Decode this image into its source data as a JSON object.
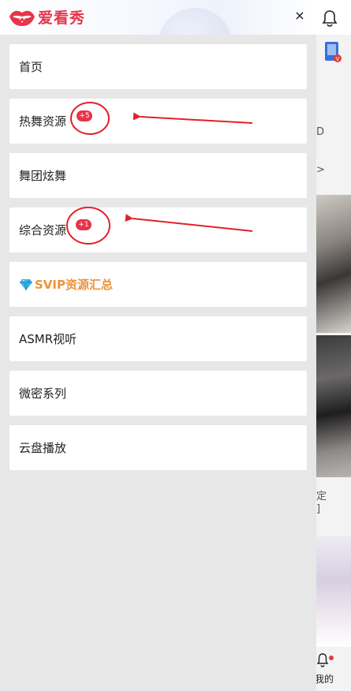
{
  "app": {
    "logo_text": "爱看秀",
    "close_glyph": "×"
  },
  "menu": {
    "items": [
      {
        "label": "首页"
      },
      {
        "label": "热舞资源",
        "badge": "+5"
      },
      {
        "label": "舞团炫舞"
      },
      {
        "label": "综合资源",
        "badge": "+1"
      },
      {
        "label": "SVIP资源汇总"
      },
      {
        "label": "ASMR视听"
      },
      {
        "label": "微密系列"
      },
      {
        "label": "云盘播放"
      }
    ]
  },
  "background_page": {
    "partial_texts": [
      "D",
      ">",
      "定",
      "]"
    ],
    "bottom_nav_label": "我的"
  },
  "colors": {
    "brand": "#e8344a",
    "svip": "#f0913a",
    "annotation": "#e3202a"
  },
  "icons": [
    "logo-lips-icon",
    "close-icon",
    "diamond-icon",
    "bell-icon",
    "game-icon"
  ]
}
